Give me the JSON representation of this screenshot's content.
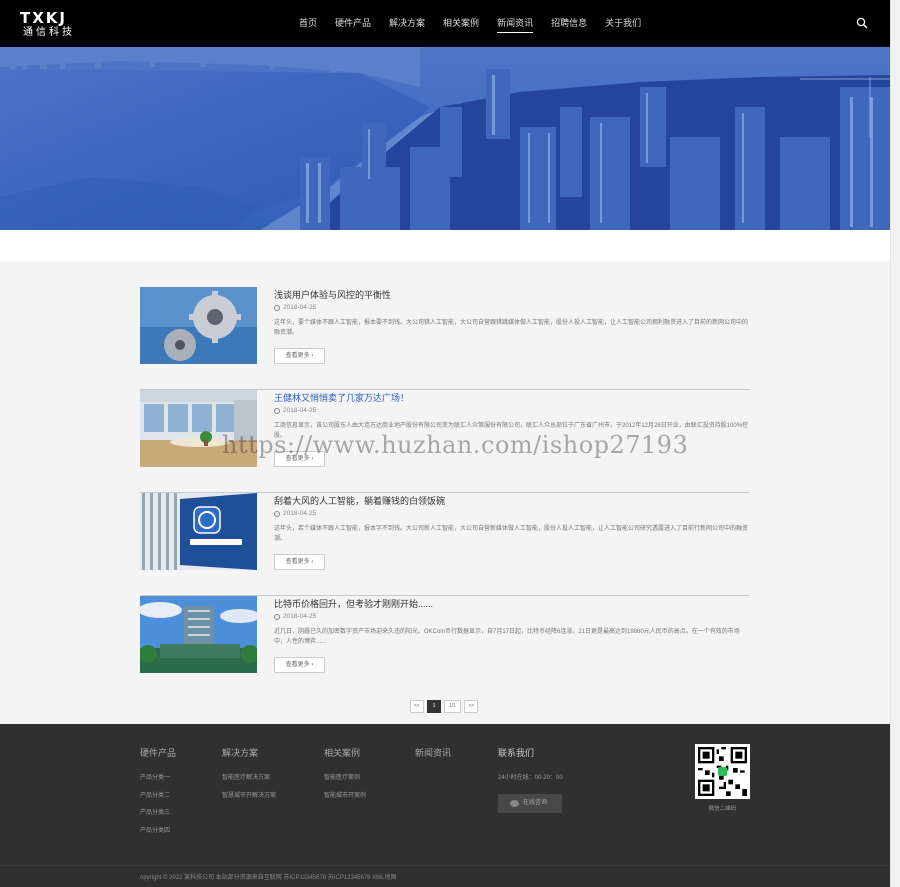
{
  "header": {
    "logo_main": "TXKJ",
    "logo_sub": "通信科技",
    "nav": [
      "首页",
      "硬件产品",
      "解决方案",
      "相关案例",
      "新闻资讯",
      "招聘信息",
      "关于我们"
    ],
    "active_nav": "新闻资讯",
    "search_icon": "search-icon"
  },
  "news": [
    {
      "title": "浅谈用户体验与风控的平衡性",
      "date": "2018-04-25",
      "desc": "这年头，要个媒体不跟人工智能，报本要不到钱。大公司猎人工智能，大公司自营跟猎跳媒体做人工智能，股份人投人工智能，让人工智能公司拥利融资进入了目前的新网公司中的融资潮。",
      "more": "查看更多 ›",
      "title_color": "#333333"
    },
    {
      "title": "王健林又悄悄卖了几家万达广场！",
      "date": "2018-04-25",
      "desc": "工商信息显示，该公司股东人由大连万达商业地产股份有限公司变为联汇人众策服份有限公司，联汇人众总部位于广东省广州市，于2012年12月28日开业，由联汇投资持股100%控股。",
      "more": "查看更多 ›",
      "title_color": "#2d5bbf"
    },
    {
      "title": "刮着大风的人工智能，躺着赚钱的白领饭碗",
      "date": "2018-04-25",
      "desc": "这年头，若个媒体不跟人工智能，报本字不到钱。大公司新人工智能，大公司自营新媒体做人工智能，股份人投人工智能，让人工智能公司研究透露进入了目前行新网公司中的融资潮。",
      "more": "查看更多 ›",
      "title_color": "#333333"
    },
    {
      "title": "比特币价格回升，但考验才刚刚开始......",
      "date": "2018-04-25",
      "desc": "近几日，阴霾已久的加密数字资产市场迎来久违的阳光。OKCoin币行数据显示，自7月17日起，比特币经降6连涨，21日更是最高达到19860元人民币的高点。在一个有效的市场中，人性的博弈......",
      "more": "查看更多 ›",
      "title_color": "#333333"
    }
  ],
  "pagination": {
    "prev": "<<",
    "current": "1",
    "total": "1/1",
    "next": ">>"
  },
  "watermark": "https://www.huzhan.com/ishop27193",
  "footer": {
    "columns": [
      {
        "title": "硬件产品",
        "links": [
          "产品分类一",
          "产品分类二",
          "产品分类三",
          "产品分类四"
        ]
      },
      {
        "title": "解决方案",
        "links": [
          "智能医疗解决方案",
          "智慧城市开解决方案"
        ]
      },
      {
        "title": "相关案例",
        "links": [
          "智能医疗案例",
          "智能城市开案例"
        ]
      },
      {
        "title": "新闻资讯",
        "links": []
      },
      {
        "title": "联系我们",
        "links": [
          "24小时在线：00-20：00"
        ]
      }
    ],
    "consult_label": "在线咨询",
    "qr_caption": "微信二维码",
    "copyright": "opyright © 2022 某科技公司 本站部分资源来自互联网 苏ICP12345678 苏ICP12345678 XML地图"
  }
}
